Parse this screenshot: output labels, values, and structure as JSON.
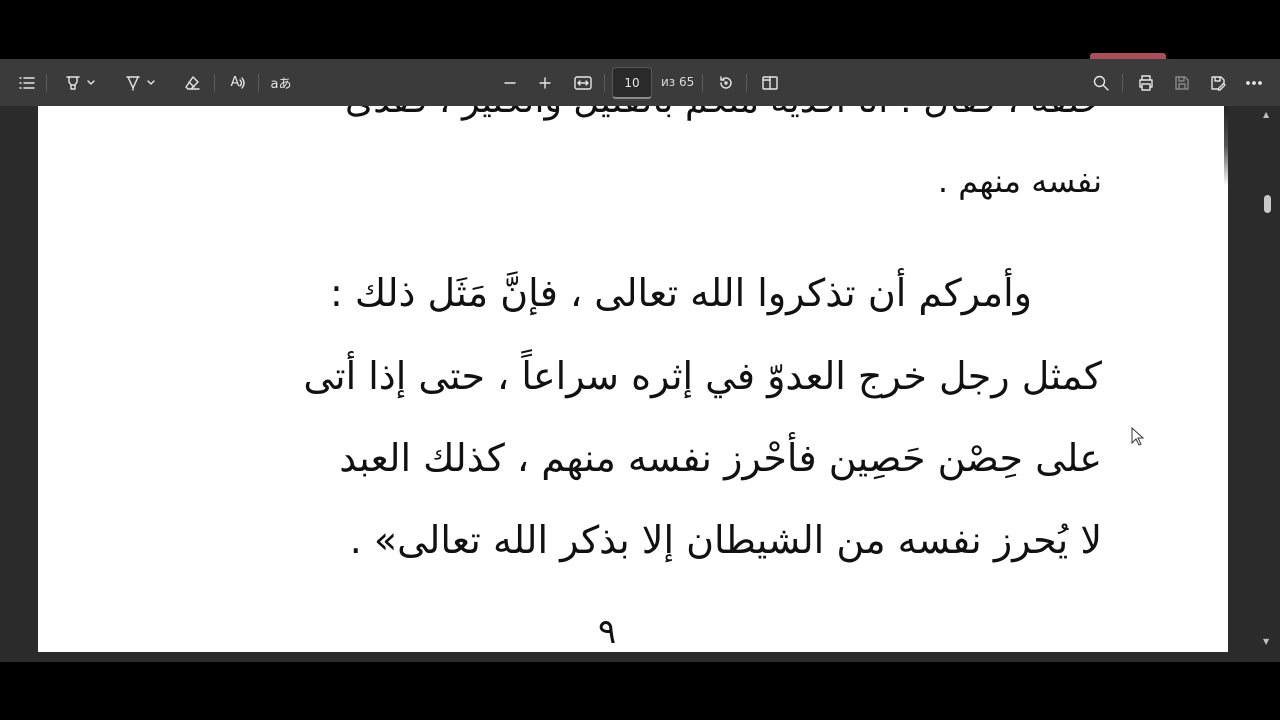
{
  "toolbar": {
    "page_current": "10",
    "page_total_label": "из 65",
    "read_aloud_glyph": "A",
    "translate_glyph": "aあ"
  },
  "document": {
    "cut_line": "خلفه ، فقال : أنا أفديه منكم بالقليل والكثير ، ففدى",
    "line1": "نفسه منهم .",
    "line2": "وأمركم أن تذكروا الله تعالى ، فإنَّ مَثَل ذلك :",
    "line3": "كمثل رجل خرج العدوّ في إثره سراعاً ، حتى إذا أتى",
    "line4": "على حِصْن حَصِين فأحْرز نفسه منهم ، كذلك العبد",
    "line5": "لا يُحرز نفسه من الشيطان إلا بذكر الله تعالى» .",
    "page_number": "٩"
  },
  "colors": {
    "toolbar_bg": "#3b3b3b",
    "viewer_bg": "#2b2b2b",
    "page_bg": "#ffffff",
    "accent": "#a8505a"
  }
}
